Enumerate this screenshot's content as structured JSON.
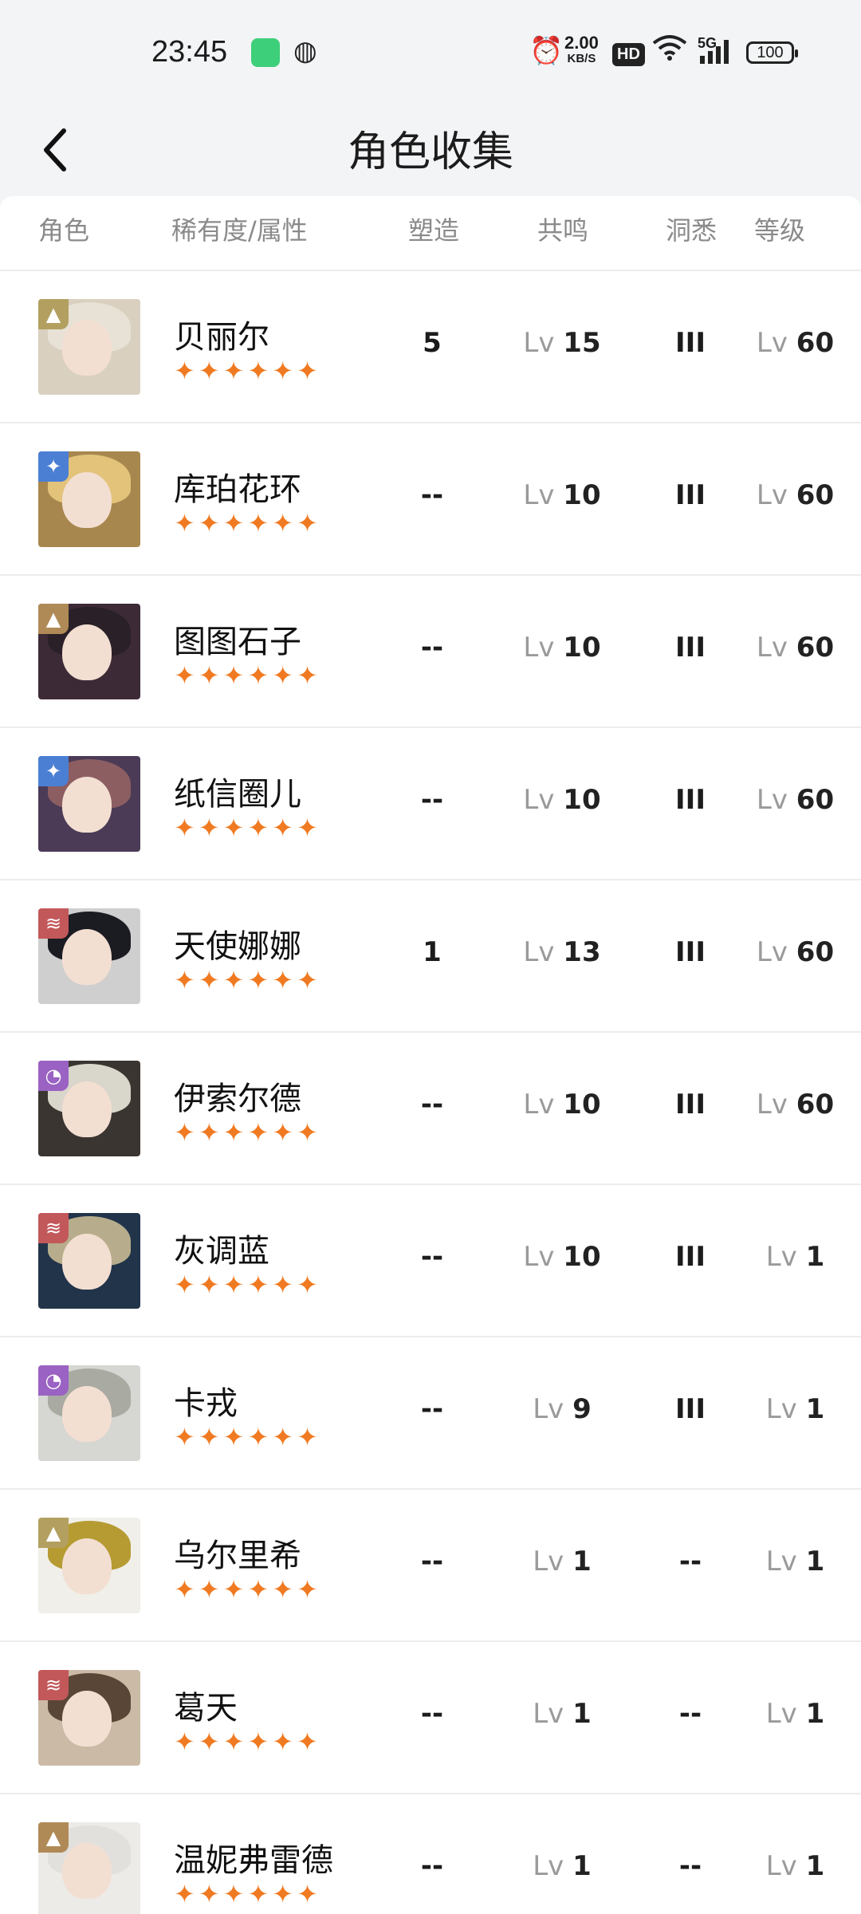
{
  "status_bar": {
    "time": "23:45",
    "speed_value": "2.00",
    "speed_unit": "KB/S",
    "hd": "HD",
    "network": "5G",
    "battery": "100"
  },
  "header": {
    "title": "角色收集",
    "back_icon": "chevron-left-icon"
  },
  "table": {
    "columns": {
      "role": "角色",
      "rarity_attr": "稀有度/属性",
      "shape": "塑造",
      "resonance": "共鸣",
      "insight": "洞悉",
      "level": "等级"
    },
    "level_prefix": "Lv",
    "rows": [
      {
        "name": "贝丽尔",
        "stars": "✦✦✦✦✦✦",
        "shape": "5",
        "resonance": "15",
        "insight": "III",
        "level": "60",
        "badge_color": "#b3a060",
        "badge_icon": "▲",
        "bg": "#d9d0c0",
        "hair": "#e8e2d6"
      },
      {
        "name": "库珀花环",
        "stars": "✦✦✦✦✦✦",
        "shape": "--",
        "resonance": "10",
        "insight": "III",
        "level": "60",
        "badge_color": "#4a7fd4",
        "badge_icon": "✦",
        "bg": "#a8874e",
        "hair": "#e3c37a"
      },
      {
        "name": "图图石子",
        "stars": "✦✦✦✦✦✦",
        "shape": "--",
        "resonance": "10",
        "insight": "III",
        "level": "60",
        "badge_color": "#b08a56",
        "badge_icon": "▲",
        "bg": "#3c2a36",
        "hair": "#2a2028"
      },
      {
        "name": "纸信圈儿",
        "stars": "✦✦✦✦✦✦",
        "shape": "--",
        "resonance": "10",
        "insight": "III",
        "level": "60",
        "badge_color": "#4a7fd4",
        "badge_icon": "✦",
        "bg": "#4b3b56",
        "hair": "#8c5e62"
      },
      {
        "name": "天使娜娜",
        "stars": "✦✦✦✦✦✦",
        "shape": "1",
        "resonance": "13",
        "insight": "III",
        "level": "60",
        "badge_color": "#c2585a",
        "badge_icon": "≋",
        "bg": "#cfcfcf",
        "hair": "#1b1b22"
      },
      {
        "name": "伊索尔德",
        "stars": "✦✦✦✦✦✦",
        "shape": "--",
        "resonance": "10",
        "insight": "III",
        "level": "60",
        "badge_color": "#9a62c2",
        "badge_icon": "◔",
        "bg": "#3a3530",
        "hair": "#d9d6cc"
      },
      {
        "name": "灰调蓝",
        "stars": "✦✦✦✦✦✦",
        "shape": "--",
        "resonance": "10",
        "insight": "III",
        "level": "1",
        "badge_color": "#c2585a",
        "badge_icon": "≋",
        "bg": "#22344a",
        "hair": "#b7ad8c"
      },
      {
        "name": "卡戎",
        "stars": "✦✦✦✦✦✦",
        "shape": "--",
        "resonance": "9",
        "insight": "III",
        "level": "1",
        "badge_color": "#9a62c2",
        "badge_icon": "◔",
        "bg": "#d6d6d2",
        "hair": "#a9aaa2"
      },
      {
        "name": "乌尔里希",
        "stars": "✦✦✦✦✦✦",
        "shape": "--",
        "resonance": "1",
        "insight": "--",
        "level": "1",
        "badge_color": "#b3a060",
        "badge_icon": "▲",
        "bg": "#f0efe9",
        "hair": "#b59b32"
      },
      {
        "name": "葛天",
        "stars": "✦✦✦✦✦✦",
        "shape": "--",
        "resonance": "1",
        "insight": "--",
        "level": "1",
        "badge_color": "#c2585a",
        "badge_icon": "≋",
        "bg": "#cbbba6",
        "hair": "#5a4636"
      },
      {
        "name": "温妮弗雷德",
        "stars": "✦✦✦✦✦✦",
        "shape": "--",
        "resonance": "1",
        "insight": "--",
        "level": "1",
        "badge_color": "#b08a56",
        "badge_icon": "▲",
        "bg": "#ecebe8",
        "hair": "#e2e0dc"
      }
    ]
  }
}
